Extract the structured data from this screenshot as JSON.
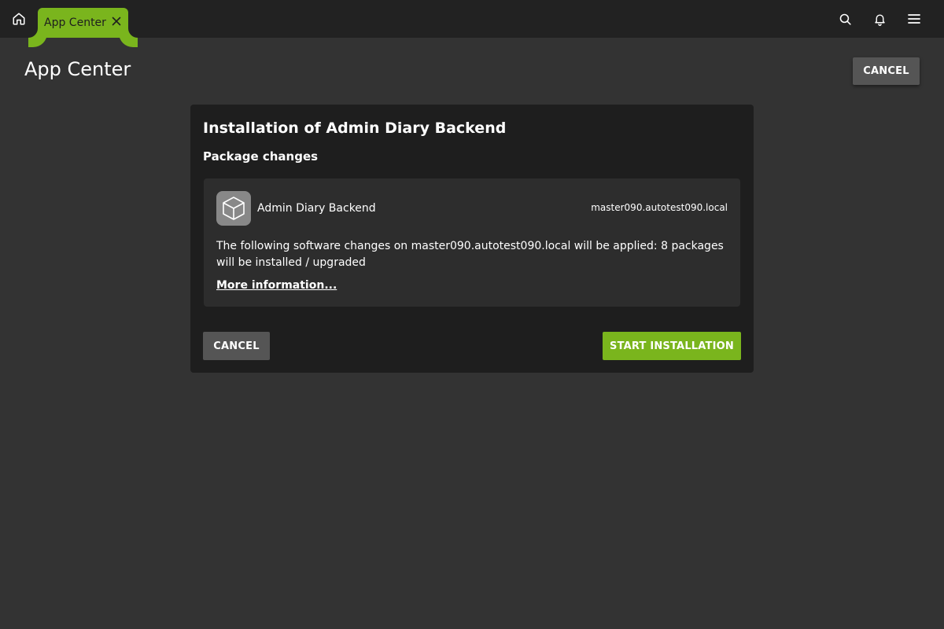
{
  "topbar": {
    "home_icon": "home-icon",
    "tab": {
      "label": "App Center",
      "close_icon": "close-icon"
    },
    "search_icon": "search-icon",
    "notifications_icon": "bell-icon",
    "menu_icon": "hamburger-menu-icon"
  },
  "page": {
    "title": "App Center",
    "cancel_label": "CANCEL"
  },
  "dialog": {
    "title": "Installation of Admin Diary Backend",
    "subtitle": "Package changes",
    "package": {
      "icon": "package-box-icon",
      "name": "Admin Diary Backend",
      "host": "master090.autotest090.local",
      "description": "The following software changes on master090.autotest090.local will be applied: 8 packages will be installed / upgraded",
      "more_info_label": "More information..."
    },
    "cancel_label": "CANCEL",
    "start_label": "START INSTALLATION"
  },
  "colors": {
    "accent": "#7ab51d",
    "topbar_bg": "#222222",
    "page_bg": "#333333",
    "card_bg": "#1e1e1e",
    "pkg_bg": "#2d2d2d",
    "secondary_button": "#555555"
  }
}
